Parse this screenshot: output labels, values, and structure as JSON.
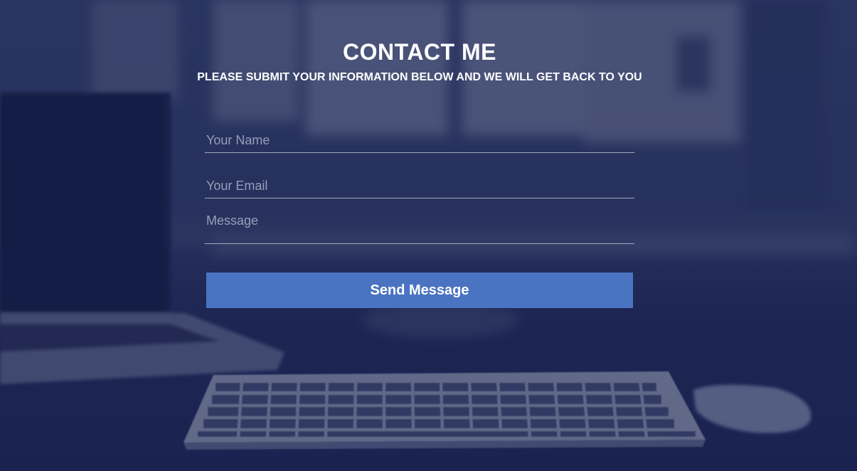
{
  "contact": {
    "title": "CONTACT ME",
    "subtitle": "PLEASE SUBMIT YOUR INFORMATION BELOW AND WE WILL GET BACK TO YOU"
  },
  "form": {
    "name_placeholder": "Your Name",
    "name_value": "",
    "email_placeholder": "Your Email",
    "email_value": "",
    "message_placeholder": "Message",
    "message_value": "",
    "submit_label": "Send Message"
  },
  "colors": {
    "overlay": "#1c2452",
    "button": "#4a74c2",
    "text": "#ffffff"
  },
  "background_image": "blurred desk with laptop, keyboard and mouse under dark blue overlay"
}
